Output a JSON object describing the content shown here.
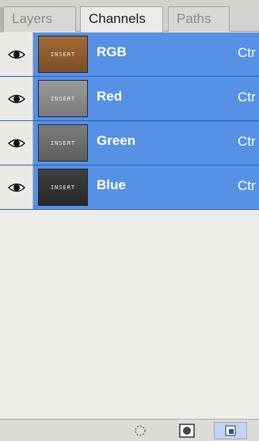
{
  "panel": {
    "tabs": [
      {
        "label": "Layers",
        "active": false
      },
      {
        "label": "Channels",
        "active": true
      },
      {
        "label": "Paths",
        "active": false
      }
    ]
  },
  "channels": [
    {
      "name": "RGB",
      "shortcut": "Ctr",
      "visible": true,
      "thumb_text": "INSERT",
      "thumb_color": "#8a5a2c"
    },
    {
      "name": "Red",
      "shortcut": "Ctr",
      "visible": true,
      "thumb_text": "INSERT",
      "thumb_color": "#8c8c8c"
    },
    {
      "name": "Green",
      "shortcut": "Ctr",
      "visible": true,
      "thumb_text": "INSERT",
      "thumb_color": "#6e6e6e"
    },
    {
      "name": "Blue",
      "shortcut": "Ctr",
      "visible": true,
      "thumb_text": "INSERT",
      "thumb_color": "#353535"
    }
  ],
  "colors": {
    "selection": "#5691e6",
    "panel_bg": "#ecebe7"
  },
  "bottom_buttons": [
    {
      "icon": "load-selection-icon"
    },
    {
      "icon": "save-selection-icon"
    },
    {
      "icon": "new-channel-icon"
    }
  ]
}
